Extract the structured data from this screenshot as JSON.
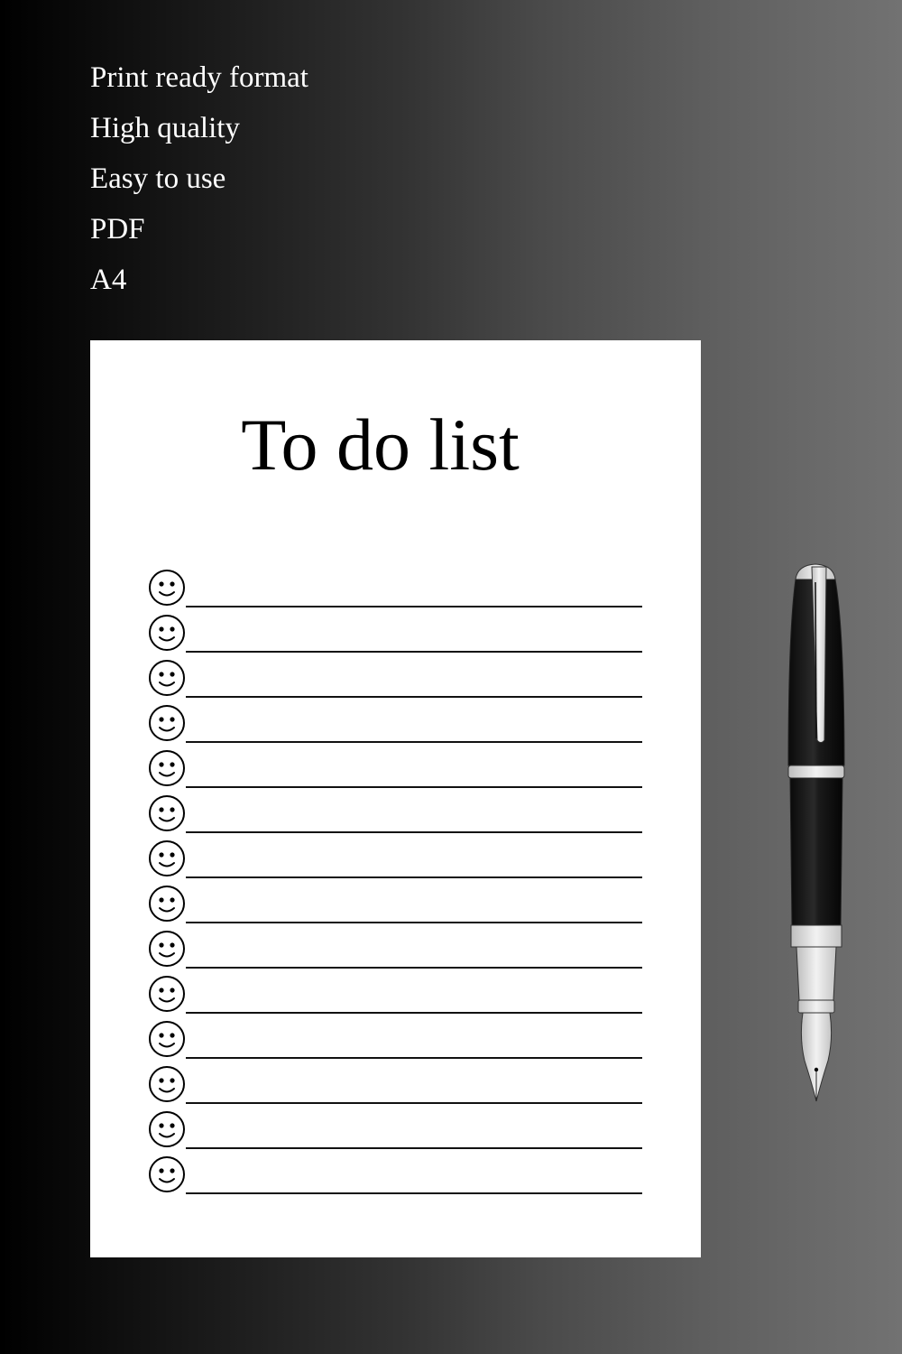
{
  "features": [
    "Print ready format",
    "High quality",
    "Easy to use",
    "PDF",
    "A4"
  ],
  "document": {
    "title": "To do list",
    "row_count": 14,
    "row_icon": "smiley-face-icon"
  },
  "decoration": {
    "pen_icon": "fountain-pen-icon"
  },
  "colors": {
    "paper": "#ffffff",
    "text_light": "#ffffff",
    "ink": "#000000",
    "bg_left": "#000000",
    "bg_right": "#727272"
  }
}
